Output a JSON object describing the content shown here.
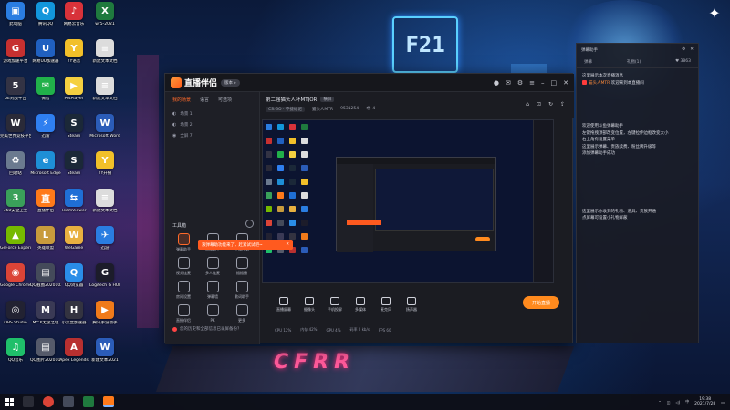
{
  "desktop_icons": [
    {
      "label": "此电脑",
      "color": "#2a7de1",
      "glyph": "▣"
    },
    {
      "label": "腾讯QQ",
      "color": "#1296db",
      "glyph": "Q"
    },
    {
      "label": "网易云音乐",
      "color": "#d8323a",
      "glyph": "♪"
    },
    {
      "label": "wr5-2021",
      "color": "#1f7a3e",
      "glyph": "X"
    },
    {
      "label": "游戏加速平台",
      "color": "#c63030",
      "glyph": "G"
    },
    {
      "label": "网易UU加速器",
      "color": "#2060c0",
      "glyph": "U"
    },
    {
      "label": "YY语音",
      "color": "#f2c029",
      "glyph": "Y"
    },
    {
      "label": "新建文本文档",
      "color": "#dcdcdc",
      "glyph": "≡"
    },
    {
      "label": "5E对战平台",
      "color": "#333344",
      "glyph": "5"
    },
    {
      "label": "微信",
      "color": "#21b14a",
      "glyph": "✉"
    },
    {
      "label": "PotPlayer",
      "color": "#f5d040",
      "glyph": "▶"
    },
    {
      "label": "新建文本文档",
      "color": "#dcdcdc",
      "glyph": "≡"
    },
    {
      "label": "完美世界竞技平台",
      "color": "#2a2a38",
      "glyph": "W"
    },
    {
      "label": "迅雷",
      "color": "#2f7ff0",
      "glyph": "⚡"
    },
    {
      "label": "Steam",
      "color": "#1b2838",
      "glyph": "S"
    },
    {
      "label": "Microsoft Word",
      "color": "#2b5cb8",
      "glyph": "W"
    },
    {
      "label": "回收站",
      "color": "#6b7a8f",
      "glyph": "♻"
    },
    {
      "label": "Microsoft Edge",
      "color": "#1e8fd6",
      "glyph": "e"
    },
    {
      "label": "Steam",
      "color": "#1b2838",
      "glyph": "S"
    },
    {
      "label": "YY开播",
      "color": "#f2c029",
      "glyph": "Y"
    },
    {
      "label": "360安全卫士",
      "color": "#3aa05a",
      "glyph": "3"
    },
    {
      "label": "直播伴侣",
      "color": "#ff7a1a",
      "glyph": "直"
    },
    {
      "label": "TeamViewer",
      "color": "#1f6fd6",
      "glyph": "⇆"
    },
    {
      "label": "新建文本文档",
      "color": "#dcdcdc",
      "glyph": "≡"
    },
    {
      "label": "GeForce Experience",
      "color": "#76b900",
      "glyph": "▲"
    },
    {
      "label": "英雄联盟",
      "color": "#c89b3c",
      "glyph": "L"
    },
    {
      "label": "WeGame",
      "color": "#e8b040",
      "glyph": "W"
    },
    {
      "label": "迅游",
      "color": "#2a7de1",
      "glyph": "✈"
    },
    {
      "label": "Google Chrome",
      "color": "#db4437",
      "glyph": "◉"
    },
    {
      "label": "QQ截图20201021",
      "color": "#444a5a",
      "glyph": "▤"
    },
    {
      "label": "QQ浏览器",
      "color": "#2a8de8",
      "glyph": "Q"
    },
    {
      "label": "Logitech G HUB",
      "color": "#1c1c2a",
      "glyph": "G"
    },
    {
      "label": "OBS Studio",
      "color": "#222232",
      "glyph": "◎"
    },
    {
      "label": "M^X无极之境",
      "color": "#3a3a55",
      "glyph": "M"
    },
    {
      "label": "小黑盒加速器",
      "color": "#333340",
      "glyph": "H"
    },
    {
      "label": "腾讯手游助手",
      "color": "#f07a1a",
      "glyph": "▶"
    },
    {
      "label": "QQ音乐",
      "color": "#1fbf6a",
      "glyph": "♫"
    },
    {
      "label": "QQ图片20201021",
      "color": "#555a6a",
      "glyph": "▤"
    },
    {
      "label": "Apex Legends",
      "color": "#b83030",
      "glyph": "A"
    },
    {
      "label": "新建文本2021",
      "color": "#2b5cb8",
      "glyph": "W"
    }
  ],
  "app": {
    "name": "直播伴侣",
    "version_badge": "版本 ▸",
    "left_tabs": [
      "我的场景",
      "语言",
      "可选项"
    ],
    "scenes": [
      "场景 1",
      "场景 2",
      "全屏 7"
    ],
    "tools_title": "工具箱",
    "tools": [
      "弹幕助手",
      "直播助手",
      "主播任务",
      "视频连麦",
      "多人连麦",
      "插插播",
      "房间设置",
      "弹幕墙",
      "歌词助手",
      "直播伴侣",
      "PK",
      "更多"
    ],
    "toast_text": "滚弹幕助功能来了，赶紧试试吧~",
    "footer_text": "您的历史和全部信息已录屏备份？",
    "room_title": "第二届猫头人杯MTJOR",
    "room_tag": "横屏",
    "room_category": "CS:GO · 不捷标记",
    "room_owner": "猫头人MTR",
    "room_id": "9531254",
    "room_viewers": "4",
    "bottom_tools": [
      "直播屏幕",
      "摄像头",
      "手机投屏",
      "多媒体",
      "麦克风",
      "扬声器"
    ],
    "start_button": "开始直播",
    "stats": [
      "CPU 12%",
      "内存 42%",
      "GPU 4%",
      "码率 0 kb/s",
      "FPS 60"
    ]
  },
  "right_panel": {
    "title": "弹幕助手",
    "tabs": [
      "弹幕",
      "礼物(1)",
      "观众"
    ],
    "count": "3863",
    "messages": [
      {
        "text": "这里展示本次直播消息"
      },
      {
        "user": "猫头人MTR",
        "text": "欢迎来到本直播间"
      },
      {
        "text": "欢迎使用斗鱼弹幕助手"
      },
      {
        "text": "左键拖拽顶部改变位置，左键拉伸边框改变大小"
      },
      {
        "text": "右上角有设置菜单"
      },
      {
        "text": "这里展示弹幕、贵族续费、粉丝牌升级等"
      },
      {
        "text": "添加弹幕助手成功"
      },
      {
        "text": "这里展示你收到的礼物、道具、贵族开通"
      },
      {
        "text": "点屏幕可设置小礼物屏蔽"
      }
    ]
  },
  "taskbar": {
    "time": "19:38",
    "date": "2021/7/28",
    "lang": "中"
  }
}
